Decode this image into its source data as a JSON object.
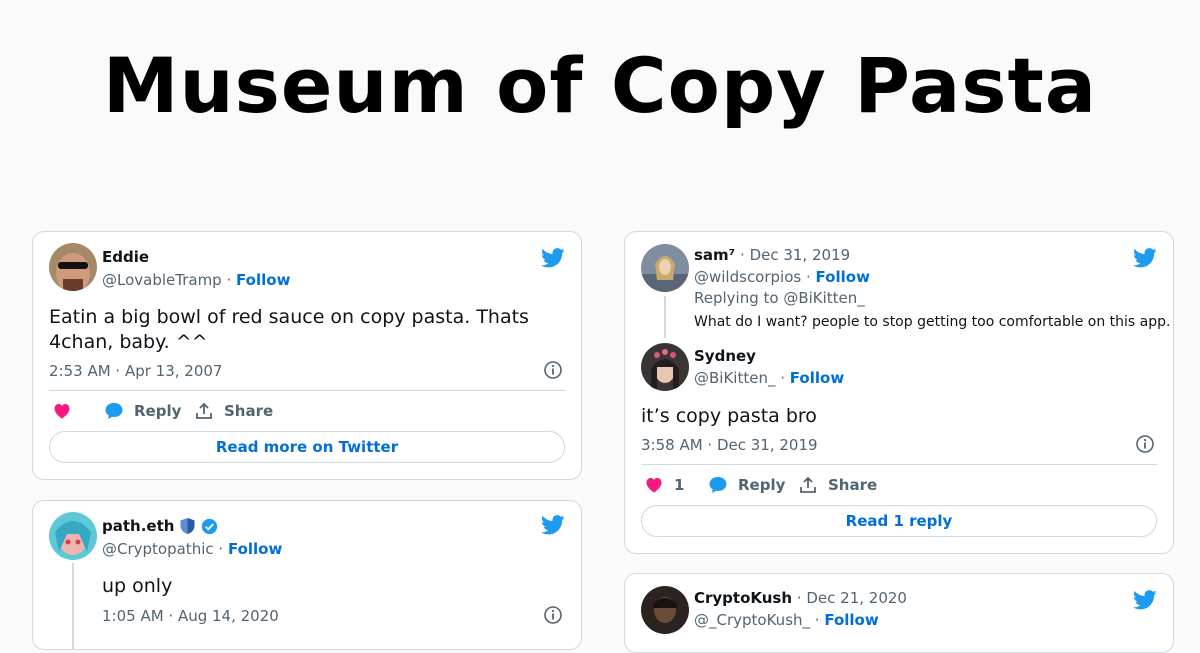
{
  "page": {
    "title": "Museum of Copy Pasta"
  },
  "colors": {
    "twitter_blue": "#1d9bf0",
    "link_blue": "#006fd6",
    "like_pink": "#f91880",
    "muted": "#536471"
  },
  "cards": {
    "eddie": {
      "name": "Eddie",
      "handle": "@LovableTramp",
      "follow_label": "Follow",
      "text": "Eatin a big bowl of red sauce on copy pasta. Thats 4chan, baby. ^^",
      "timestamp": "2:53 AM · Apr 13, 2007",
      "reply_label": "Reply",
      "share_label": "Share",
      "read_more_label": "Read more on Twitter",
      "icons": [
        "twitter-bird-icon",
        "info-icon",
        "heart-icon",
        "reply-bubble-icon",
        "share-icon"
      ]
    },
    "sam": {
      "name": "sam⁷",
      "date": "Dec 31, 2019",
      "handle": "@wildscorpios",
      "follow_label": "Follow",
      "replying_to": "Replying to @BiKitten_",
      "text": "What do I want? people to stop getting too comfortable on this app."
    },
    "sydney": {
      "name": "Sydney",
      "handle": "@BiKitten_",
      "follow_label": "Follow",
      "text": "it’s copy pasta bro",
      "timestamp": "3:58 AM · Dec 31, 2019",
      "like_count": "1",
      "reply_label": "Reply",
      "share_label": "Share",
      "read_reply_label": "Read 1 reply"
    },
    "path": {
      "name": "path.eth",
      "handle": "@Cryptopathic",
      "follow_label": "Follow",
      "text": "up only",
      "timestamp": "1:05 AM · Aug 14, 2020"
    },
    "cryptokush": {
      "name": "CryptoKush",
      "date": "Dec 21, 2020",
      "handle": "@_CryptoKush_",
      "follow_label": "Follow"
    }
  }
}
